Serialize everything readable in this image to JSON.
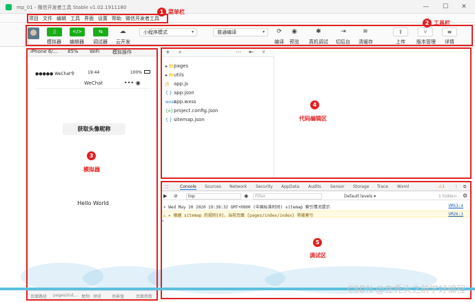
{
  "window": {
    "title": "mp_01 - 微信开发者工具 Stable v1.02.1911180"
  },
  "menu": [
    "项目",
    "文件",
    "编辑",
    "工具",
    "界面",
    "设置",
    "帮助",
    "微信开发者工具"
  ],
  "toolbar": {
    "simulator": "模拟器",
    "editor": "编辑器",
    "debugger": "调试器",
    "cloud": "云开发",
    "mode_select": "小程序模式",
    "compile_select": "普通编译",
    "compile": "编译",
    "preview": "预览",
    "remote_debug": "真机调试",
    "background": "切后台",
    "clear_cache": "清缓存",
    "upload": "上传",
    "version": "版本管理",
    "details": "详情"
  },
  "annotations": {
    "menubar": {
      "num": "1",
      "label": "菜单栏"
    },
    "toolbar": {
      "num": "2",
      "label": "工具栏"
    },
    "simulator": {
      "num": "3",
      "label": "模拟器"
    },
    "editor": {
      "num": "4",
      "label": "代码编辑区"
    },
    "debugger": {
      "num": "5",
      "label": "调试区"
    }
  },
  "simulator": {
    "device": "iPhone 6/...",
    "zoom": "85%",
    "network": "WiFi",
    "ops": "模拟操作",
    "carrier": "●●●●● WeChat令",
    "time": "19:44",
    "battery": "100%",
    "nav_title": "WeChat",
    "capsule": "•••  ◉",
    "button": "获取头像昵称",
    "hello": "Hello World"
  },
  "sim_footer": {
    "path_label": "页面路径",
    "path": "pages/ind...",
    "copy": "复制",
    "preview": "预览",
    "scene": "场景值",
    "params": "页面参数"
  },
  "files": [
    {
      "icon": "▸ 📁",
      "name": "pages"
    },
    {
      "icon": "▸ 📁",
      "name": "utils"
    },
    {
      "icon": "JS",
      "name": "app.js"
    },
    {
      "icon": "{ }",
      "name": "app.json"
    },
    {
      "icon": "wxss",
      "name": "app.wxss"
    },
    {
      "icon": "{o}",
      "name": "project.config.json"
    },
    {
      "icon": "{ }",
      "name": "sitemap.json"
    }
  ],
  "console": {
    "tabs": [
      "Console",
      "Sources",
      "Network",
      "Security",
      "AppData",
      "Audits",
      "Sensor",
      "Storage",
      "Trace",
      "Wxml"
    ],
    "context": "top",
    "filter_placeholder": "Filter",
    "levels": "Default levels ▾",
    "hidden": "1 hidden",
    "warning_count": "1",
    "log1": "▾ Wed May 20 2020 19:38:32 GMT+0800 (中国标准时间) sitemap 索引情况提示",
    "log1_src": "VM53:4",
    "log2": "⚠ ▸ 根据 sitemap 的规则[0]，当前页面 [pages/index/index] 将被索引",
    "log2_src": "VM26:1",
    "prompt": ">"
  },
  "watermark": "CSDN @在秃头之前学好编程"
}
